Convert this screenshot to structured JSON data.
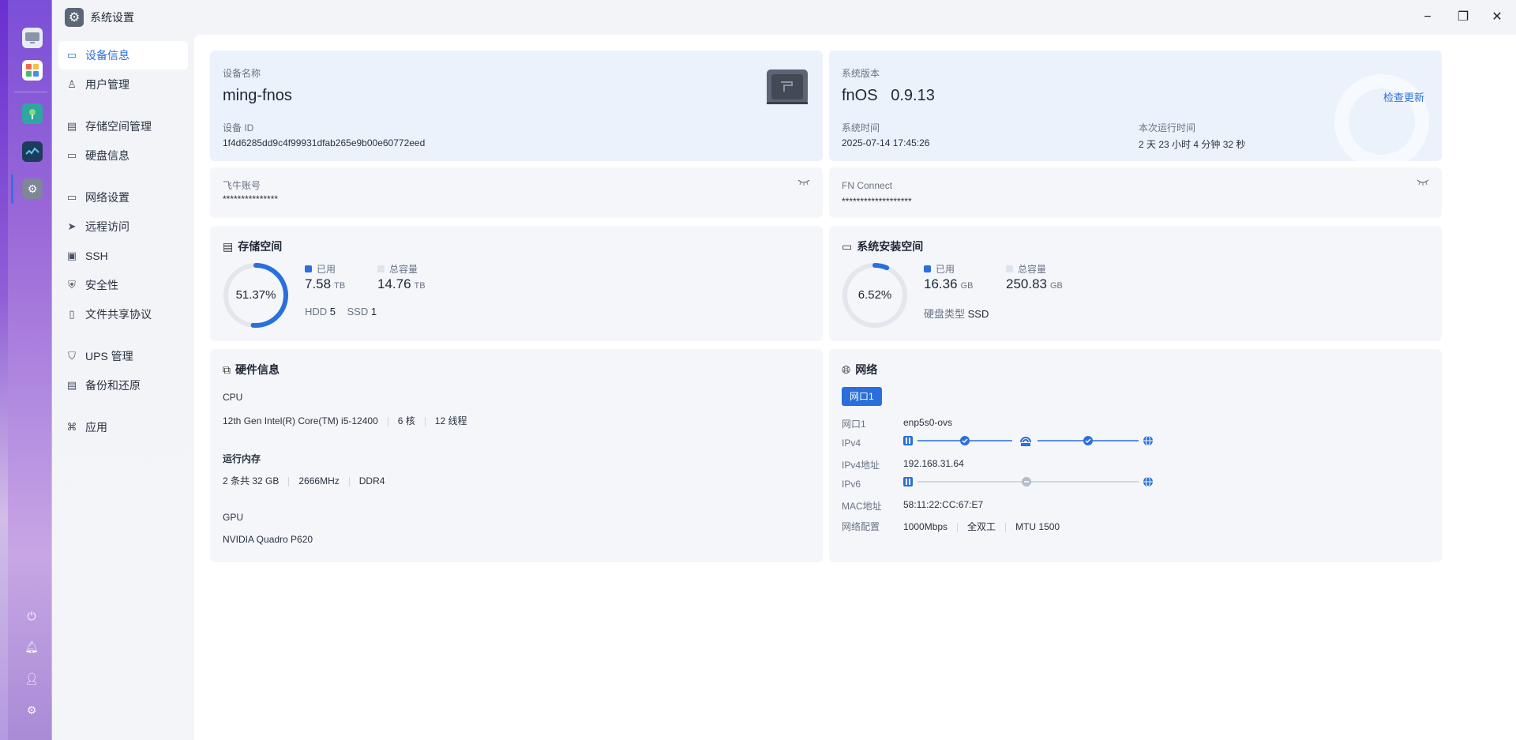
{
  "window": {
    "title": "系统设置",
    "minimize_label": "−",
    "maximize_label": "❐",
    "close_label": "✕"
  },
  "sidebar": {
    "items": [
      {
        "label": "设备信息",
        "icon": "device-info-icon"
      },
      {
        "label": "用户管理",
        "icon": "user-icon"
      },
      {
        "label": "存储空间管理",
        "icon": "storage-icon"
      },
      {
        "label": "硬盘信息",
        "icon": "disk-icon"
      },
      {
        "label": "网络设置",
        "icon": "network-icon"
      },
      {
        "label": "远程访问",
        "icon": "remote-icon"
      },
      {
        "label": "SSH",
        "icon": "ssh-icon"
      },
      {
        "label": "安全性",
        "icon": "shield-icon"
      },
      {
        "label": "文件共享协议",
        "icon": "file-share-icon"
      },
      {
        "label": "UPS 管理",
        "icon": "ups-icon"
      },
      {
        "label": "备份和还原",
        "icon": "backup-icon"
      },
      {
        "label": "应用",
        "icon": "apps-icon"
      }
    ]
  },
  "device": {
    "name_label": "设备名称",
    "name": "ming-fnos",
    "id_label": "设备 ID",
    "id": "1f4d6285dd9c4f99931dfab265e9b00e60772eed"
  },
  "system": {
    "version_label": "系统版本",
    "version": "fnOS   0.9.13",
    "check_update": "检查更新",
    "time_label": "系统时间",
    "time": "2025-07-14 17:45:26",
    "uptime_label": "本次运行时间",
    "uptime": "2 天 23 小时 4 分钟 32 秒"
  },
  "account": {
    "label": "飞牛账号",
    "value": "***************"
  },
  "fnconnect": {
    "label": "FN Connect",
    "value": "*******************"
  },
  "storage": {
    "title": "存储空间",
    "percent": "51.37%",
    "percent_value": 51.37,
    "used_label": "已用",
    "used": "7.58",
    "used_unit": "TB",
    "total_label": "总容量",
    "total": "14.76",
    "total_unit": "TB",
    "hdd_label": "HDD",
    "hdd": "5",
    "ssd_label": "SSD",
    "ssd": "1"
  },
  "sys_space": {
    "title": "系统安装空间",
    "percent": "6.52%",
    "percent_value": 6.52,
    "used_label": "已用",
    "used": "16.36",
    "used_unit": "GB",
    "total_label": "总容量",
    "total": "250.83",
    "total_unit": "GB",
    "disk_type_label": "硬盘类型",
    "disk_type": "SSD"
  },
  "hardware": {
    "title": "硬件信息",
    "cpu_label": "CPU",
    "cpu_model": "12th Gen Intel(R) Core(TM) i5-12400",
    "cpu_cores": "6 核",
    "cpu_threads": "12 线程",
    "mem_label": "运行内存",
    "mem_size": "2 条共 32 GB",
    "mem_speed": "2666MHz",
    "mem_type": "DDR4",
    "gpu_label": "GPU",
    "gpu_model": "NVIDIA Quadro P620"
  },
  "network": {
    "title": "网络",
    "tab": "网口1",
    "port_label": "网口1",
    "port": "enp5s0-ovs",
    "ipv4_label": "IPv4",
    "ipv4_addr_label": "IPv4地址",
    "ipv4_addr": "192.168.31.64",
    "ipv6_label": "IPv6",
    "mac_label": "MAC地址",
    "mac": "58:11:22:CC:67:E7",
    "config_label": "网络配置",
    "speed": "1000Mbps",
    "duplex": "全双工",
    "mtu": "MTU 1500"
  },
  "colors": {
    "accent": "#2a6fdb",
    "ring_track": "#e3e6ec"
  }
}
